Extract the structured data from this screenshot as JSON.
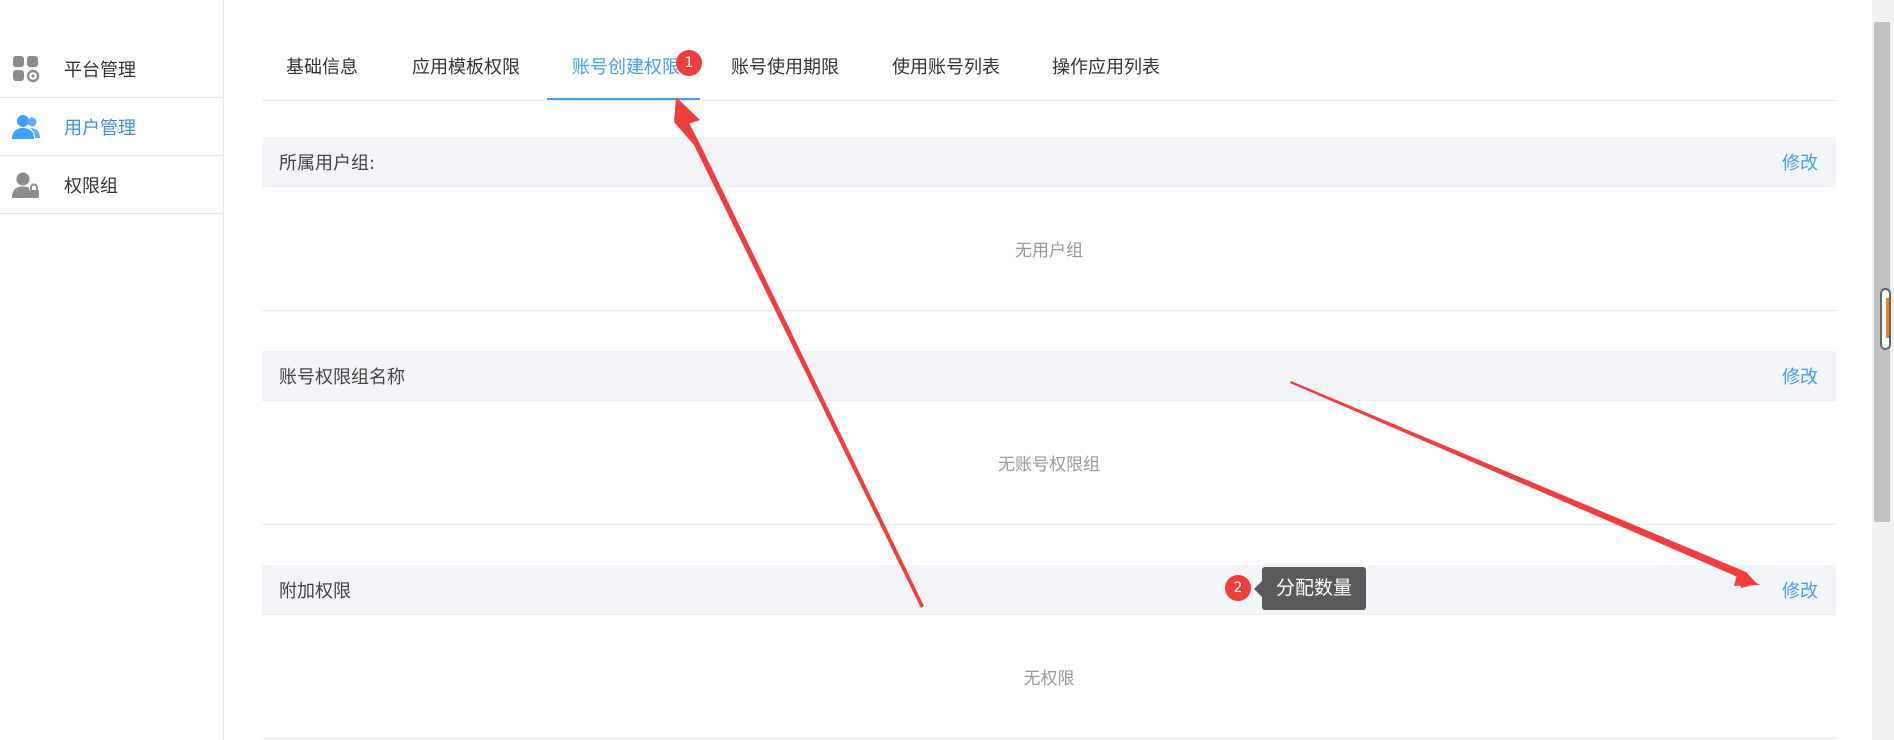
{
  "sidebar": {
    "items": [
      {
        "label": "平台管理",
        "icon": "grid-settings-icon"
      },
      {
        "label": "用户管理",
        "icon": "users-icon",
        "active": true
      },
      {
        "label": "权限组",
        "icon": "user-lock-icon"
      }
    ]
  },
  "tabs": [
    {
      "label": "基础信息"
    },
    {
      "label": "应用模板权限"
    },
    {
      "label": "账号创建权限",
      "active": true
    },
    {
      "label": "账号使用期限"
    },
    {
      "label": "使用账号列表"
    },
    {
      "label": "操作应用列表"
    }
  ],
  "panels": [
    {
      "title": "所属用户组:",
      "action": "修改",
      "empty": "无用户组"
    },
    {
      "title": "账号权限组名称",
      "action": "修改",
      "empty": "无账号权限组"
    },
    {
      "title": "附加权限",
      "action": "修改",
      "empty": "无权限"
    }
  ],
  "annotations": {
    "badge1": "1",
    "badge2": "2",
    "tooltip": "分配数量",
    "color": "#f03d3d"
  },
  "colors": {
    "accent": "#409eff",
    "header_bg": "#f4f5f9",
    "annotation": "#f03d3d"
  }
}
